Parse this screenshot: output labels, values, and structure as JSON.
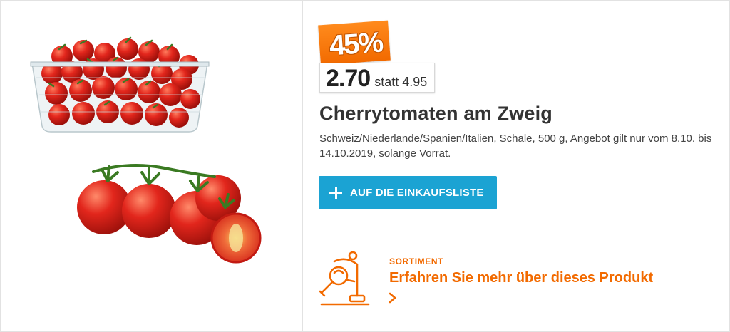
{
  "offer": {
    "discount": "45%",
    "price_current": "2.70",
    "price_statt": "statt",
    "price_old": "4.95"
  },
  "product": {
    "title": "Cherrytomaten am Zweig",
    "description": "Schweiz/Niederlande/Spanien/Italien, Schale, 500 g, Angebot gilt nur vom 8.10. bis 14.10.2019, solange Vorrat."
  },
  "actions": {
    "add_to_list_label": "AUF DIE EINKAUFSLISTE",
    "add_icon": "plus-icon"
  },
  "sortiment": {
    "kicker": "SORTIMENT",
    "link_text": "Erfahren Sie mehr über dieses Produkt",
    "icon": "product-search-icon",
    "chevron_icon": "chevron-right-icon"
  },
  "colors": {
    "accent_orange": "#f26a00",
    "button_blue": "#1ba3d3",
    "tomato_red": "#d8231b"
  }
}
